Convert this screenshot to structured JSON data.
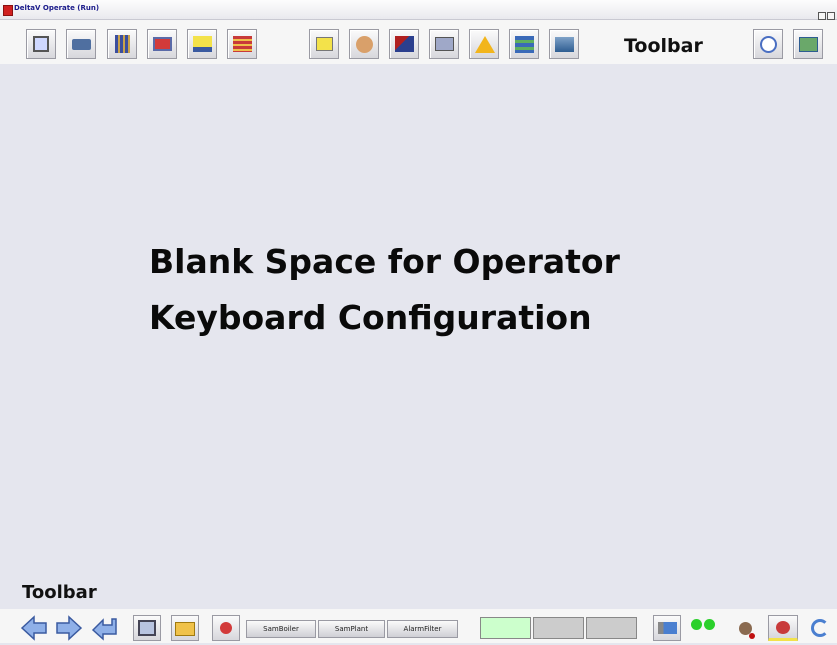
{
  "window": {
    "title": "DeltaV Operate (Run)"
  },
  "top_toolbar": {
    "label": "Toolbar",
    "buttons": [
      {
        "icon": "restore-display-icon"
      },
      {
        "icon": "print-icon"
      },
      {
        "icon": "faceplate-icon"
      },
      {
        "icon": "detail-display-icon"
      },
      {
        "icon": "alarm-summary-icon"
      },
      {
        "icon": "alarm-list-icon"
      },
      {
        "icon": "event-chronicle-icon"
      },
      {
        "icon": "user-login-icon"
      },
      {
        "icon": "diagnostics-icon"
      },
      {
        "icon": "trend-icon"
      },
      {
        "icon": "alarm-horn-icon"
      },
      {
        "icon": "control-studio-icon"
      },
      {
        "icon": "process-history-icon"
      },
      {
        "icon": "clock-icon"
      },
      {
        "icon": "workstation-switch-icon"
      }
    ]
  },
  "main": {
    "line1": "Blank Space for Operator",
    "line2": "Keyboard Configuration"
  },
  "bottom_toolbar": {
    "label": "Toolbar",
    "tabs": [
      "SamBoiler",
      "SamPlant",
      "AlarmFilter"
    ],
    "icons": [
      "back-arrow-icon",
      "forward-arrow-icon",
      "return-arrow-icon",
      "main-display-icon",
      "open-folder-icon",
      "acknowledge-icon",
      "monitor-icon",
      "status-lights-icon",
      "horn-silence-icon",
      "alarm-acknowledge-icon",
      "refresh-icon"
    ],
    "status_colors": [
      "#ccffcc",
      "#cccccc",
      "#cccccc"
    ]
  }
}
